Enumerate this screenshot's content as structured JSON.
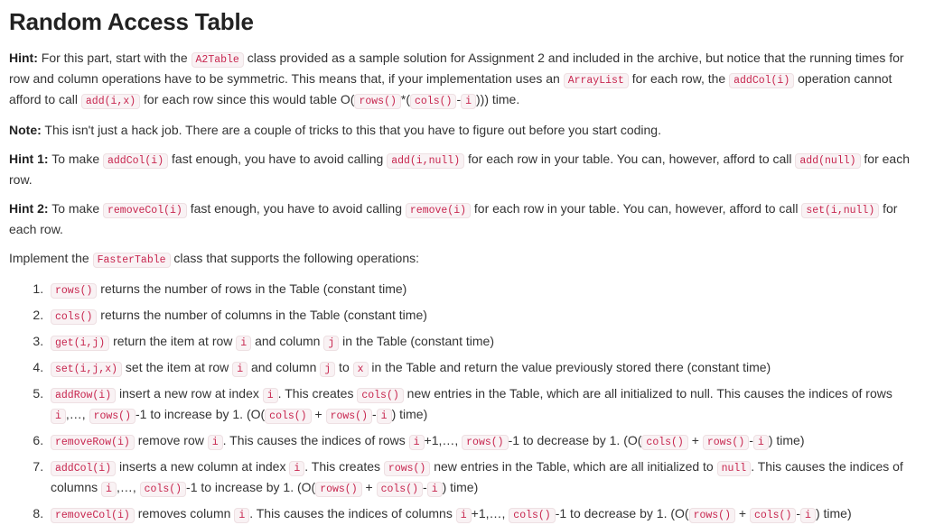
{
  "document": {
    "title": "Random Access Table"
  },
  "paragraphs": {
    "hint": {
      "label": "Hint:",
      "t1": " For this part, start with the ",
      "c1": "A2Table",
      "t2": " class provided as a sample solution for Assignment 2 and included in the archive, but notice that the running times for row and column operations have to be symmetric. This means that, if your implementation uses an ",
      "c2": "ArrayList",
      "t3": " for each row, the ",
      "c3": "addCol(i)",
      "t4": " operation cannot afford to call ",
      "c4": "add(i,x)",
      "t5": " for each row since this would table O(",
      "c5": "rows()",
      "t6": "*(",
      "c6": "cols()",
      "t7": "-",
      "c7": "i",
      "t8": "))) time."
    },
    "note": {
      "label": "Note:",
      "t1": " This isn't just a hack job. There are a couple of tricks to this that you have to figure out before you start coding."
    },
    "hint1": {
      "label": "Hint 1:",
      "t1": " To make ",
      "c1": "addCol(i)",
      "t2": " fast enough, you have to avoid calling ",
      "c2": "add(i,null)",
      "t3": " for each row in your table. You can, however, afford to call ",
      "c3": "add(null)",
      "t4": " for each row."
    },
    "hint2": {
      "label": "Hint 2:",
      "t1": " To make ",
      "c1": "removeCol(i)",
      "t2": " fast enough, you have to avoid calling ",
      "c2": "remove(i)",
      "t3": " for each row in your table. You can, however, afford to call ",
      "c3": "set(i,null)",
      "t4": " for each row."
    },
    "implement": {
      "t1": "Implement the ",
      "c1": "FasterTable",
      "t2": " class that supports the following operations:"
    }
  },
  "operations": {
    "item1": {
      "c1": "rows()",
      "t1": " returns the number of rows in the Table (constant time)"
    },
    "item2": {
      "c1": "cols()",
      "t1": " returns the number of columns in the Table (constant time)"
    },
    "item3": {
      "c1": "get(i,j)",
      "t1": " return the item at row ",
      "c2": "i",
      "t2": " and column ",
      "c3": "j",
      "t3": " in the Table (constant time)"
    },
    "item4": {
      "c1": "set(i,j,x)",
      "t1": " set the item at row ",
      "c2": "i",
      "t2": " and column ",
      "c3": "j",
      "t3": " to ",
      "c4": "x",
      "t4": " in the Table and return the value previously stored there (constant time)"
    },
    "item5": {
      "c1": "addRow(i)",
      "t1": " insert a new row at index ",
      "c2": "i",
      "t2": ". This creates ",
      "c3": "cols()",
      "t3": " new entries in the Table, which are all initialized to null. This causes the indices of rows ",
      "c4": "i",
      "t4": ",…, ",
      "c5": "rows()",
      "t5": "-1 to increase by 1. (O(",
      "c6": "cols()",
      "t6": " + ",
      "c7": "rows()",
      "t7": "-",
      "c8": "i",
      "t8": ") time)"
    },
    "item6": {
      "c1": "removeRow(i)",
      "t1": " remove row ",
      "c2": "i",
      "t2": ". This causes the indices of rows ",
      "c3": "i",
      "t3": "+1,…, ",
      "c4": "rows()",
      "t4": "-1 to decrease by 1. (O(",
      "c5": "cols()",
      "t5": " + ",
      "c6": "rows()",
      "t6": "-",
      "c7": "i",
      "t7": ") time)"
    },
    "item7": {
      "c1": "addCol(i)",
      "t1": " inserts a new column at index ",
      "c2": "i",
      "t2": ". This creates ",
      "c3": "rows()",
      "t3": " new entries in the Table, which are all initialized to ",
      "c4": "null",
      "t4": ". This causes the indices of columns ",
      "c5": "i",
      "t5": ",…, ",
      "c6": "cols()",
      "t6": "-1 to increase by 1. (O(",
      "c7": "rows()",
      "t7": " + ",
      "c8": "cols()",
      "t8": "-",
      "c9": "i",
      "t9": ") time)"
    },
    "item8": {
      "c1": "removeCol(i)",
      "t1": " removes column ",
      "c2": "i",
      "t2": ". This causes the indices of columns ",
      "c3": "i",
      "t3": "+1,…, ",
      "c4": "cols()",
      "t4": "-1 to decrease by 1. (O(",
      "c5": "rows()",
      "t5": " + ",
      "c6": "cols()",
      "t6": "-",
      "c7": "i",
      "t7": ") time)"
    }
  },
  "colors": {
    "code_text": "#c7254e",
    "code_background": "#f9f2f4",
    "body_text": "#333333",
    "heading_text": "#222222"
  }
}
